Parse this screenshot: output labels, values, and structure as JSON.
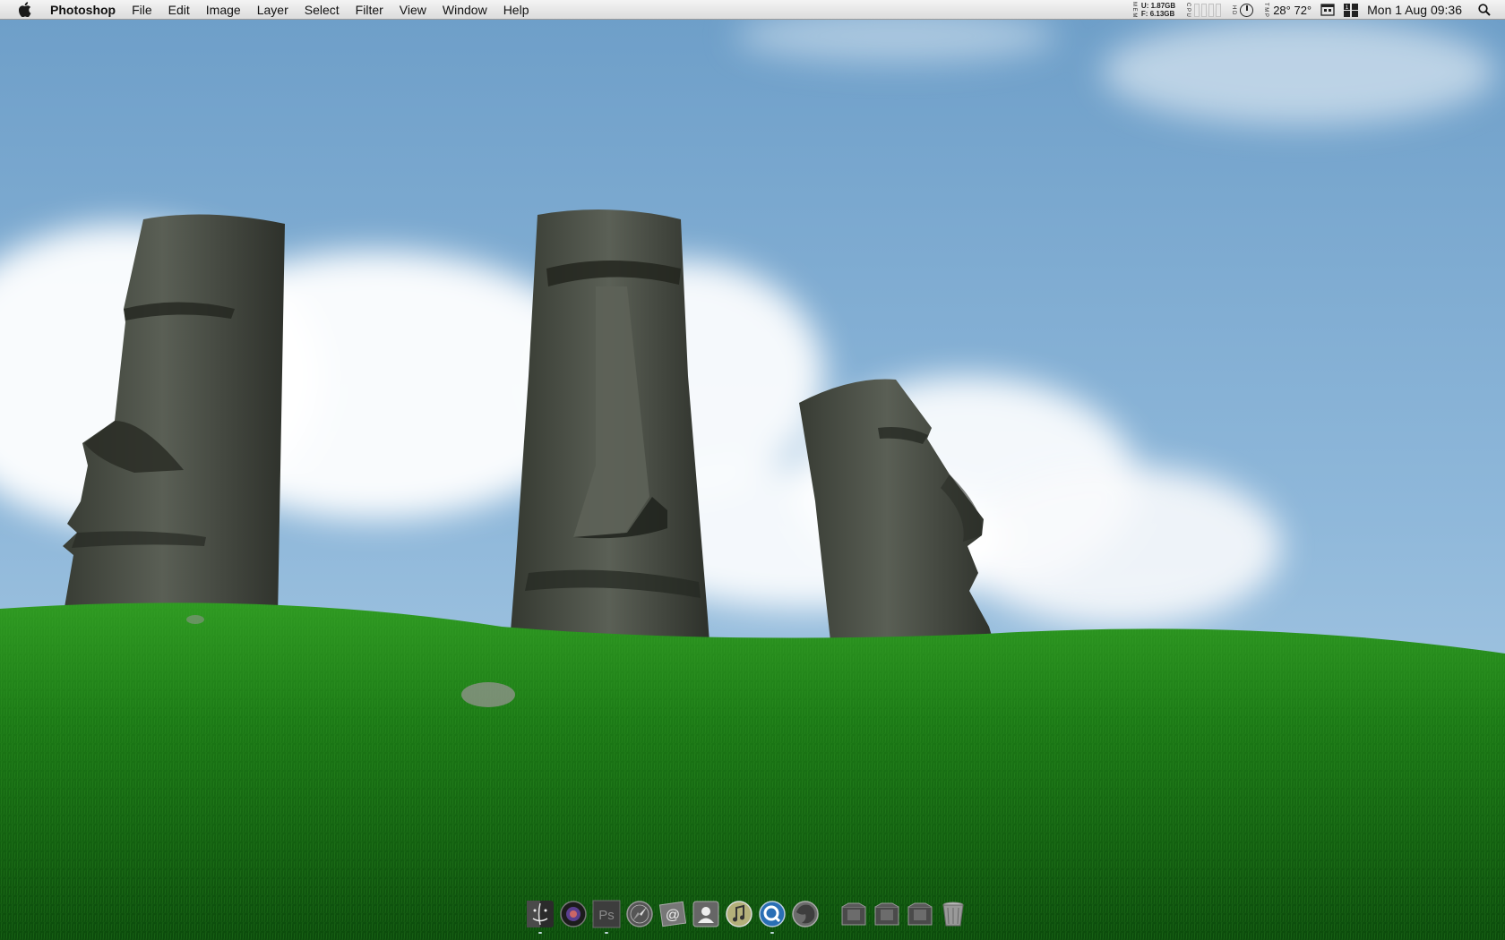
{
  "menubar": {
    "apple_icon": "apple-logo-icon",
    "app_name": "Photoshop",
    "menus": [
      "File",
      "Edit",
      "Image",
      "Layer",
      "Select",
      "Filter",
      "View",
      "Window",
      "Help"
    ]
  },
  "status": {
    "mem_label_top": "M E M",
    "mem_used_label": "U:",
    "mem_used": "1.87GB",
    "mem_free_label": "F:",
    "mem_free": "6.13GB",
    "cpu_label": "C P U",
    "hd_label": "H D",
    "tmp_label": "T M P",
    "temperature": "28° 72°",
    "clock": "Mon 1 Aug  09:36",
    "icons": [
      "calendar-icon",
      "spaces-icon",
      "spotlight-icon"
    ]
  },
  "dock": {
    "apps": [
      {
        "name": "finder-icon"
      },
      {
        "name": "aperture-icon"
      },
      {
        "name": "photoshop-icon",
        "text": "Ps"
      },
      {
        "name": "safari-icon"
      },
      {
        "name": "mail-icon"
      },
      {
        "name": "address-book-icon"
      },
      {
        "name": "itunes-icon"
      },
      {
        "name": "quicktime-icon"
      },
      {
        "name": "firefox-icon"
      }
    ],
    "stacks": [
      "applications-stack-icon",
      "documents-stack-icon",
      "downloads-stack-icon",
      "trash-icon"
    ]
  },
  "colors": {
    "sky_top": "#6f9fc8",
    "sky_bottom": "#a9c9e2",
    "grass": "#1f7a1a",
    "stone": "#4a4e46"
  }
}
